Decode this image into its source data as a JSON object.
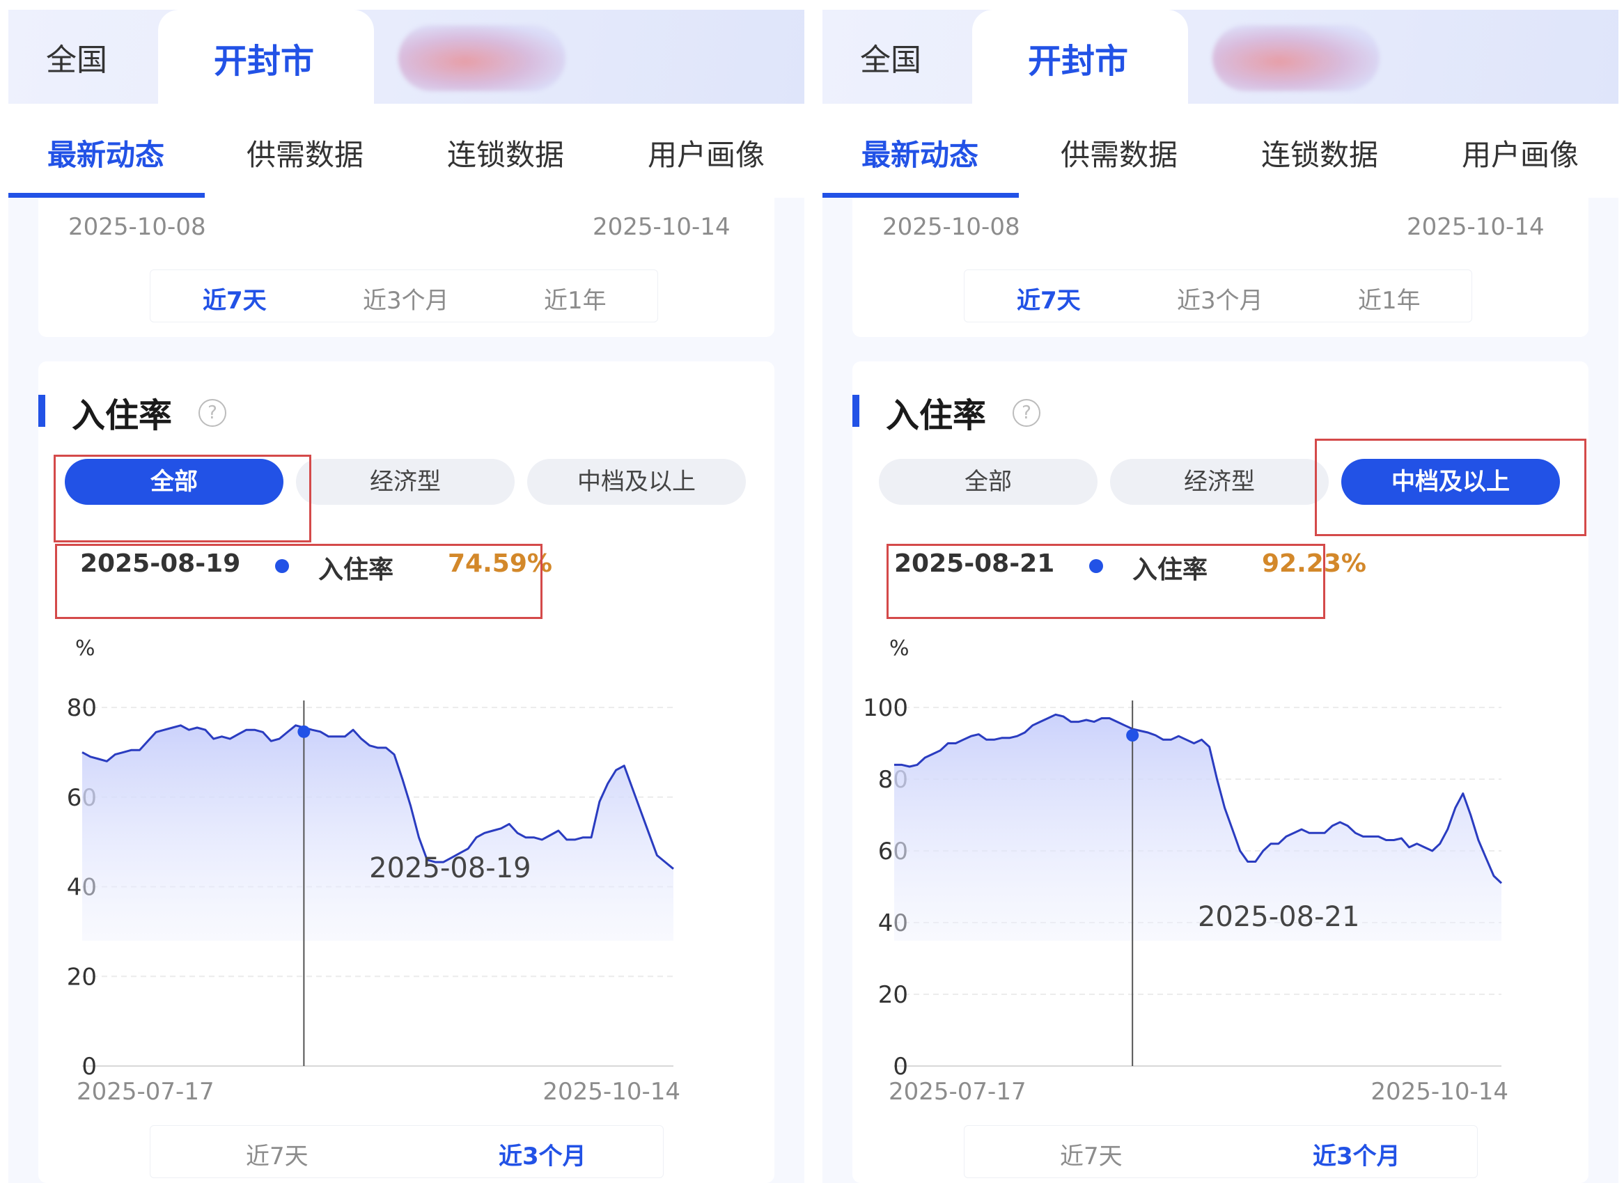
{
  "panels": [
    {
      "id": "left",
      "top_tabs": {
        "national": "全国",
        "city": "开封市"
      },
      "sub_tabs": [
        "最新动态",
        "供需数据",
        "连锁数据",
        "用户画像"
      ],
      "top_card": {
        "date_start": "2025-10-08",
        "date_end": "2025-10-14",
        "ranges": [
          "近7天",
          "近3个月",
          "近1年"
        ],
        "active_range": 0
      },
      "section": {
        "title": "入住率",
        "help": "?"
      },
      "filters": [
        "全部",
        "经济型",
        "中档及以上"
      ],
      "active_filter": 0,
      "tooltip": {
        "date": "2025-08-19",
        "label": "入住率",
        "value": "74.59%"
      },
      "bottom_ranges": [
        "近7天",
        "近3个月"
      ],
      "active_bottom_range": 1,
      "colors": {
        "accent": "#2252e6",
        "value": "#d3882a",
        "highlight": "#d44a4a"
      },
      "chart_data": {
        "type": "area",
        "unit": "%",
        "x_start": "2025-07-17",
        "x_end": "2025-10-14",
        "ylim": [
          0,
          80
        ],
        "yticks": [
          0,
          20,
          40,
          60,
          80
        ],
        "grid": true,
        "crosshair_date": "2025-08-19",
        "crosshair_value": 74.59,
        "values": [
          70,
          69,
          68.5,
          68,
          69.5,
          70,
          70.5,
          70.5,
          72.5,
          74.5,
          75,
          75.5,
          76,
          75,
          75.5,
          75,
          73,
          73.5,
          73,
          74,
          75,
          75,
          74.5,
          72.5,
          73,
          74.5,
          76,
          75.5,
          75,
          74.59,
          73.5,
          73.5,
          73.5,
          75,
          73,
          71.5,
          71,
          71,
          69.5,
          64,
          58,
          51,
          46,
          45.5,
          45.5,
          46.5,
          47.5,
          48.5,
          51,
          52,
          52.5,
          53,
          54,
          52,
          51,
          51,
          50.5,
          51.5,
          52.5,
          50.5,
          50.5,
          51,
          51,
          59,
          63,
          66,
          67,
          62,
          57,
          52,
          47,
          45.5,
          44
        ]
      }
    },
    {
      "id": "right",
      "top_tabs": {
        "national": "全国",
        "city": "开封市"
      },
      "sub_tabs": [
        "最新动态",
        "供需数据",
        "连锁数据",
        "用户画像"
      ],
      "top_card": {
        "date_start": "2025-10-08",
        "date_end": "2025-10-14",
        "ranges": [
          "近7天",
          "近3个月",
          "近1年"
        ],
        "active_range": 0
      },
      "section": {
        "title": "入住率",
        "help": "?"
      },
      "filters": [
        "全部",
        "经济型",
        "中档及以上"
      ],
      "active_filter": 2,
      "tooltip": {
        "date": "2025-08-21",
        "label": "入住率",
        "value": "92.23%"
      },
      "bottom_ranges": [
        "近7天",
        "近3个月"
      ],
      "active_bottom_range": 1,
      "colors": {
        "accent": "#2252e6",
        "value": "#d3882a",
        "highlight": "#d44a4a"
      },
      "chart_data": {
        "type": "area",
        "unit": "%",
        "x_start": "2025-07-17",
        "x_end": "2025-10-14",
        "ylim": [
          0,
          100
        ],
        "yticks": [
          0,
          20,
          40,
          60,
          80,
          100
        ],
        "grid": true,
        "crosshair_date": "2025-08-21",
        "crosshair_value": 92.23,
        "values": [
          84,
          84,
          83.5,
          84,
          86,
          87,
          88,
          90,
          90,
          91,
          92,
          92.5,
          91,
          91,
          91.5,
          91.5,
          92,
          93,
          95,
          96,
          97,
          98,
          97.5,
          96,
          96,
          96.5,
          96,
          97,
          97,
          96,
          95,
          94,
          93.5,
          93,
          92.23,
          91,
          91,
          92,
          91,
          90,
          91,
          89,
          80,
          72,
          66,
          60,
          57,
          57,
          60,
          62,
          62,
          64,
          65,
          66,
          65,
          65,
          65,
          67,
          68,
          67,
          65,
          64,
          64,
          64,
          63,
          63,
          63.5,
          61,
          62,
          61,
          60,
          62,
          66,
          72,
          76,
          70,
          63,
          58,
          53,
          51
        ]
      }
    }
  ]
}
